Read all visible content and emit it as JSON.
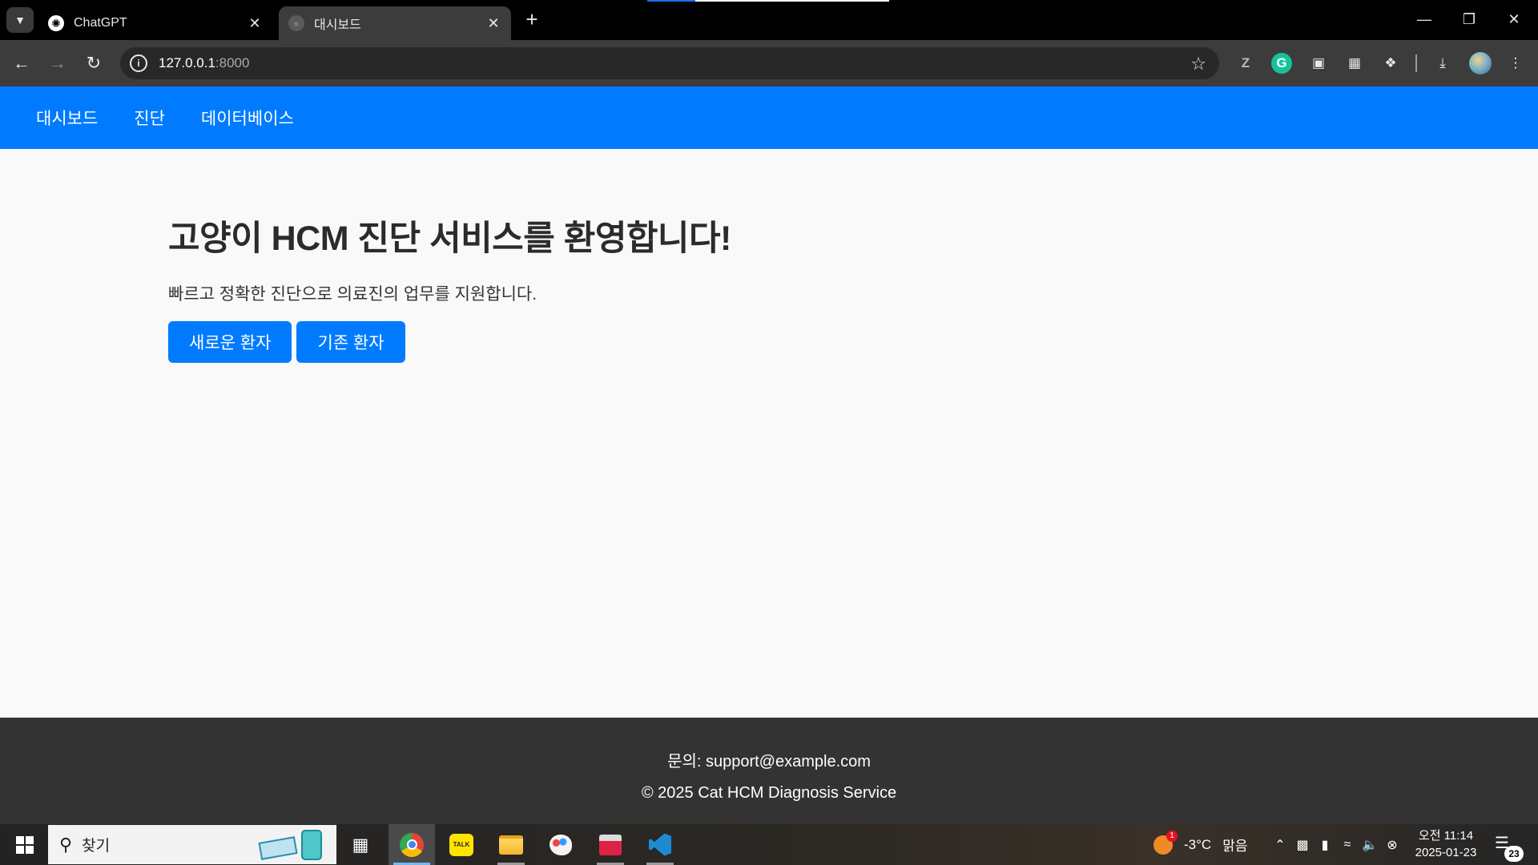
{
  "browser": {
    "tabs": [
      {
        "title": "ChatGPT",
        "favicon": "chatgpt-icon",
        "active": false
      },
      {
        "title": "대시보드",
        "favicon": "globe-icon",
        "active": true
      }
    ],
    "address": {
      "host": "127.0.0.1",
      "port": ":8000"
    }
  },
  "site": {
    "nav": [
      "대시보드",
      "진단",
      "데이터베이스"
    ],
    "hero": {
      "title": "고양이 HCM 진단 서비스를 환영합니다!",
      "subtitle": "빠르고 정확한 진단으로 의료진의 업무를 지원합니다.",
      "buttons": [
        "새로운 환자",
        "기존 환자"
      ]
    },
    "footer": {
      "contact": "문의: support@example.com",
      "copyright": "© 2025 Cat HCM Diagnosis Service"
    },
    "colors": {
      "primary": "#007bff",
      "footer_bg": "#333333",
      "page_bg": "#f9f9f9"
    }
  },
  "taskbar": {
    "search_placeholder": "찾기",
    "weather": {
      "temp": "-3°C",
      "condition": "맑음",
      "badge": "1"
    },
    "clock": {
      "time": "오전 11:14",
      "date": "2025-01-23"
    },
    "notifications": "23"
  }
}
